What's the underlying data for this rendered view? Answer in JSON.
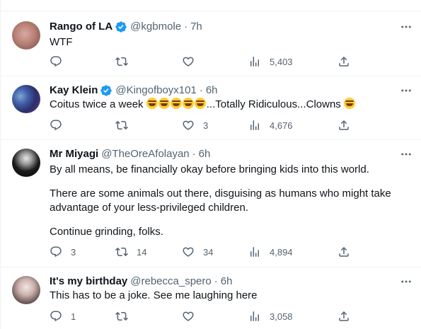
{
  "tweets": [
    {
      "name": "Rango of LA",
      "handle": "@kgbmole",
      "time": "7h",
      "verified": true,
      "text_lines": [
        "WTF"
      ],
      "replies": "",
      "retweets": "",
      "likes": "",
      "views": "5,403"
    },
    {
      "name": "Kay Klein",
      "handle": "@Kingofboyx101",
      "time": "6h",
      "verified": true,
      "text_pre": "Coitus twice a week ",
      "text_post": "...Totally Ridiculous...Clowns ",
      "replies": "",
      "retweets": "",
      "likes": "3",
      "views": "4,676"
    },
    {
      "name": "Mr Miyagi",
      "handle": "@TheOreAfolayan",
      "time": "6h",
      "verified": false,
      "text_lines": [
        "By all means, be financially okay before bringing kids into this world.",
        "There are some animals out there, disguising as humans who might take",
        "advantage of your less-privileged children.",
        "Continue grinding, folks."
      ],
      "replies": "3",
      "retweets": "14",
      "likes": "34",
      "views": "4,894"
    },
    {
      "name": "It's my birthday",
      "handle": "@rebecca_spero",
      "time": "6h",
      "verified": false,
      "text_lines": [
        "This has to be a joke. See me laughing here"
      ],
      "replies": "1",
      "retweets": "",
      "likes": "",
      "views": "3,058"
    }
  ],
  "separator": "·",
  "colors": {
    "text": "#0f1419",
    "secondary": "#536471",
    "verified": "#1d9bf0",
    "border": "#eff3f4"
  },
  "icons": [
    "reply-icon",
    "retweet-icon",
    "like-icon",
    "views-icon",
    "share-icon",
    "more-icon",
    "verified-badge-icon"
  ]
}
